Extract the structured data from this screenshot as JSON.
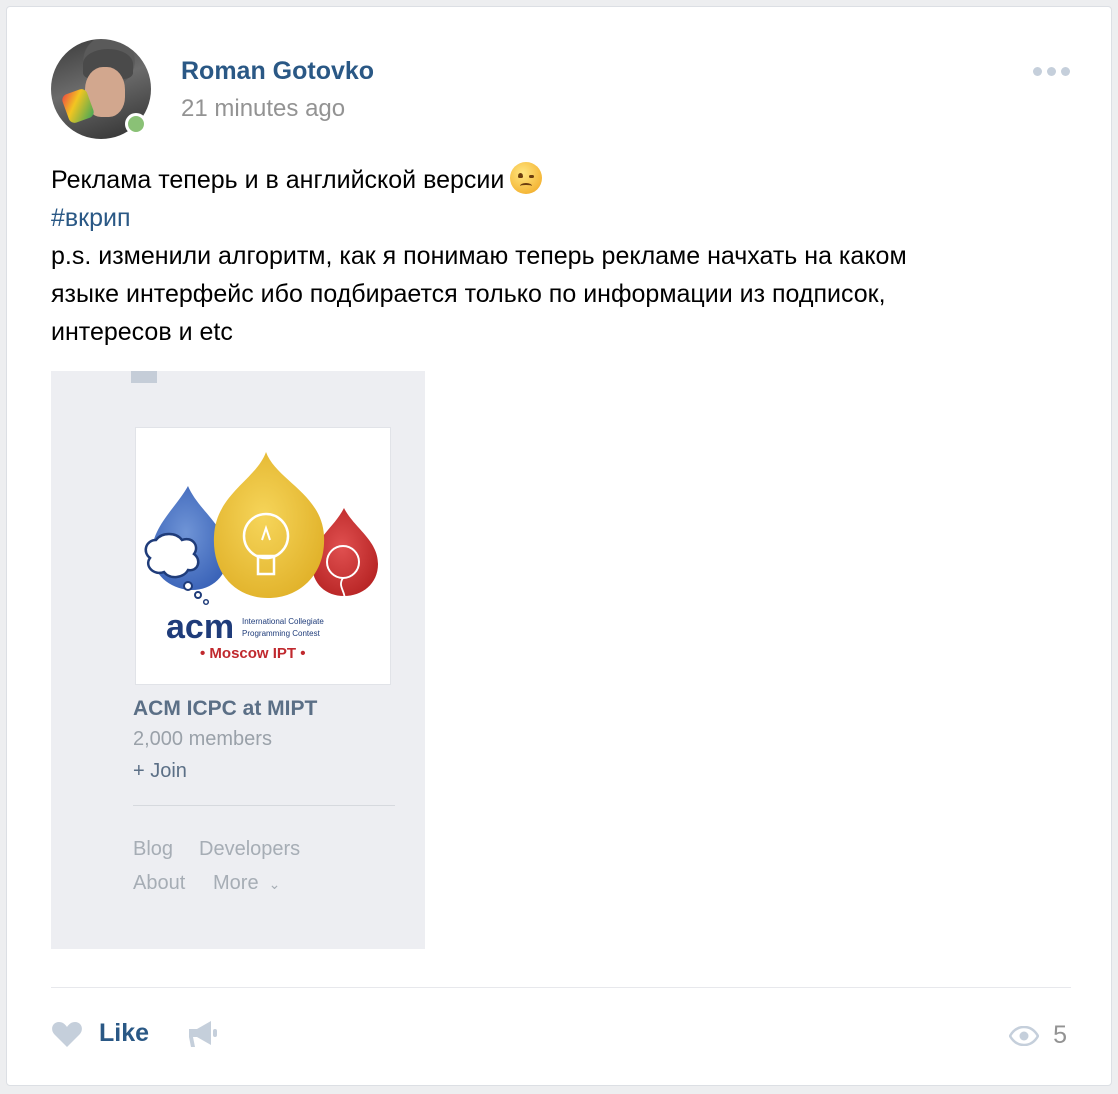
{
  "post": {
    "author": "Roman Gotovko",
    "time": "21 minutes ago",
    "text_line1": "Реклама теперь и в английской версии",
    "hashtag": "#вкрип",
    "text_line2": "p.s. изменили алгоритм, как я понимаю теперь рекламе начхать на каком",
    "text_line3": "языке интерфейс ибо подбирается только по информации из подписок,",
    "text_line4": "интересов и etc"
  },
  "attachment": {
    "ad": {
      "image_text": {
        "acm": "acm",
        "contest_line1": "International Collegiate",
        "contest_line2": "Programming Contest",
        "moscow": "• Moscow IPT •"
      },
      "title": "ACM ICPC at MIPT",
      "members": "2,000 members",
      "join": "+ Join"
    },
    "footer": {
      "blog": "Blog",
      "developers": "Developers",
      "about": "About",
      "more": "More"
    }
  },
  "actions": {
    "like_label": "Like",
    "views_count": "5"
  },
  "colors": {
    "link": "#2a5885",
    "muted": "#939393",
    "online": "#8ac176",
    "icon": "#c5cfdb"
  }
}
